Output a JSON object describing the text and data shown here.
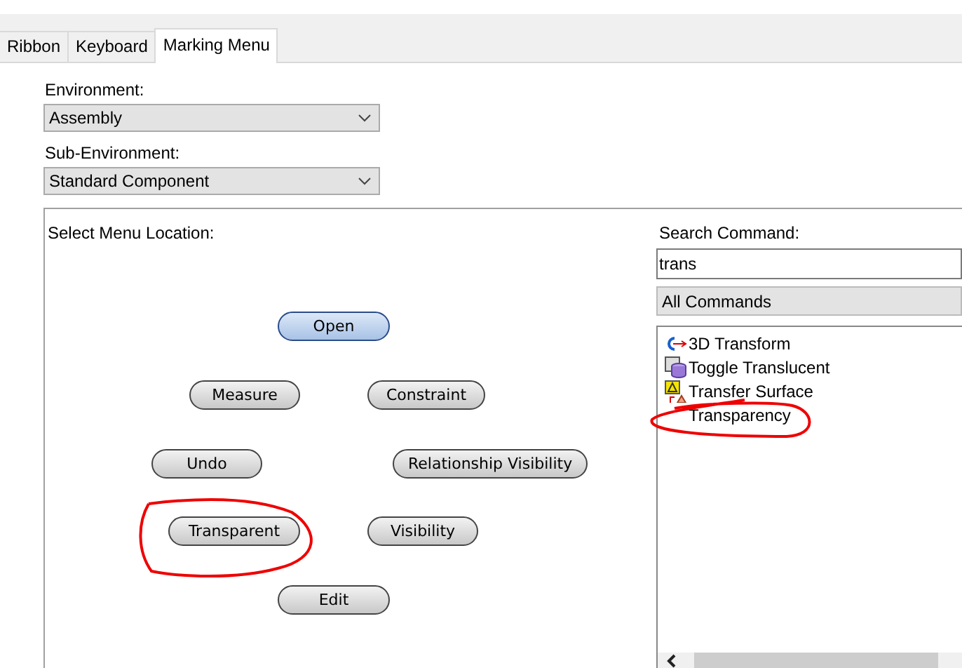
{
  "tabs": [
    {
      "label": "Ribbon",
      "selected": false
    },
    {
      "label": "Keyboard",
      "selected": false
    },
    {
      "label": "Marking Menu",
      "selected": true
    }
  ],
  "environment": {
    "label": "Environment:",
    "value": "Assembly"
  },
  "sub_environment": {
    "label": "Sub-Environment:",
    "value": "Standard Component"
  },
  "menu_location": {
    "label": "Select Menu Location:",
    "items": [
      {
        "label": "Open",
        "selected": true
      },
      {
        "label": "Measure",
        "selected": false
      },
      {
        "label": "Constraint",
        "selected": false
      },
      {
        "label": "Undo",
        "selected": false
      },
      {
        "label": "Relationship Visibility",
        "selected": false
      },
      {
        "label": "Transparent",
        "selected": false
      },
      {
        "label": "Visibility",
        "selected": false
      },
      {
        "label": "Edit",
        "selected": false
      }
    ]
  },
  "search": {
    "label": "Search Command:",
    "value": "trans"
  },
  "category": {
    "value": "All Commands"
  },
  "commands": [
    {
      "label": "3D Transform",
      "kind": "transform"
    },
    {
      "label": "Toggle Translucent",
      "kind": "toggle"
    },
    {
      "label": "Transfer Surface",
      "kind": "surface"
    },
    {
      "label": "Transparency",
      "kind": "plain"
    }
  ]
}
